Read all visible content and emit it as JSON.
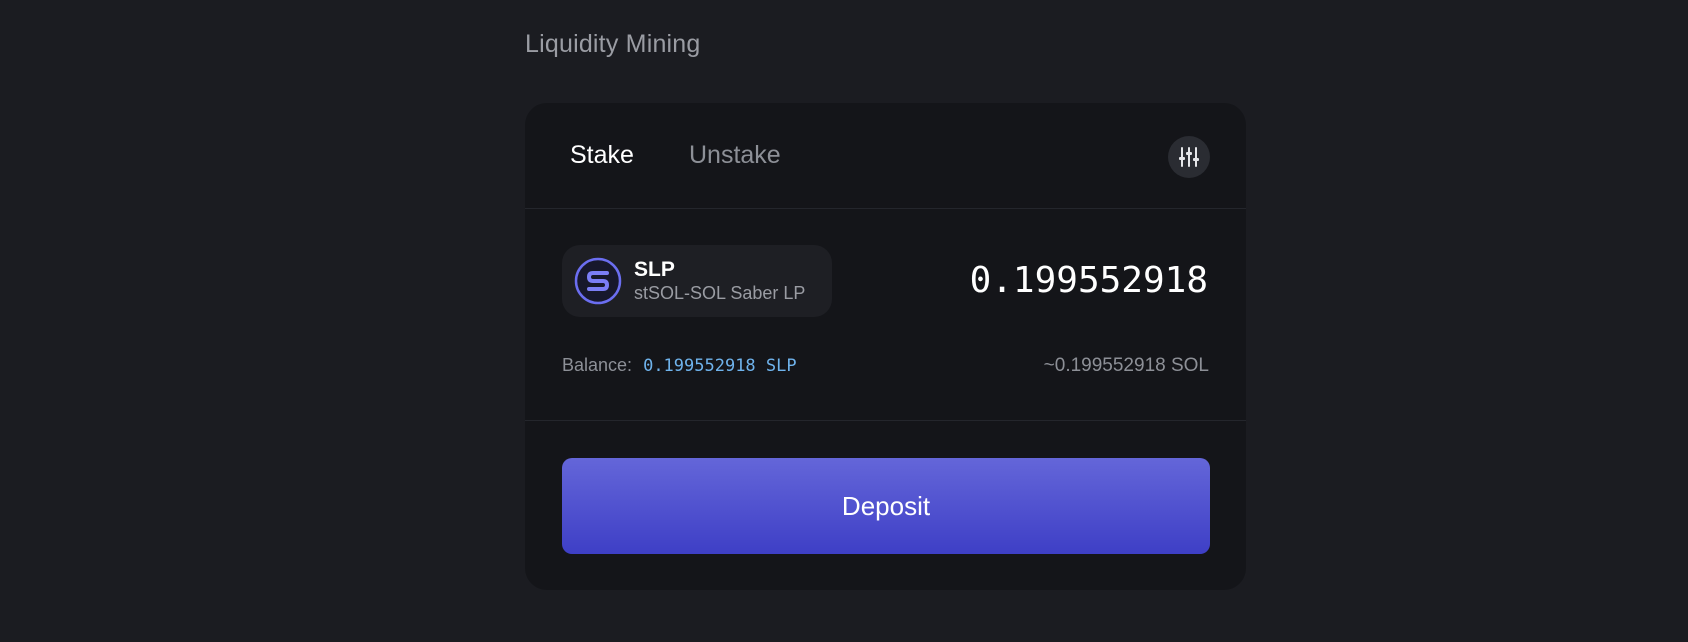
{
  "page": {
    "section_title": "Liquidity Mining"
  },
  "tabs": [
    {
      "label": "Stake",
      "active": true
    },
    {
      "label": "Unstake",
      "active": false
    }
  ],
  "settings": {
    "icon": "sliders-icon"
  },
  "token": {
    "symbol": "SLP",
    "name": "stSOL-SOL Saber LP",
    "logo_icon": "saber-logo-icon",
    "logo_color": "#6b6ef0"
  },
  "amount": {
    "value": "0.199552918"
  },
  "balance": {
    "label": "Balance:",
    "value": "0.199552918 SLP",
    "equivalent": "~0.199552918 SOL"
  },
  "actions": {
    "deposit_label": "Deposit"
  },
  "colors": {
    "background": "#1b1c21",
    "card": "#141519",
    "accent_gradient_top": "#6466d9",
    "accent_gradient_bottom": "#3e3fc6",
    "link_blue": "#6fb3ec"
  }
}
